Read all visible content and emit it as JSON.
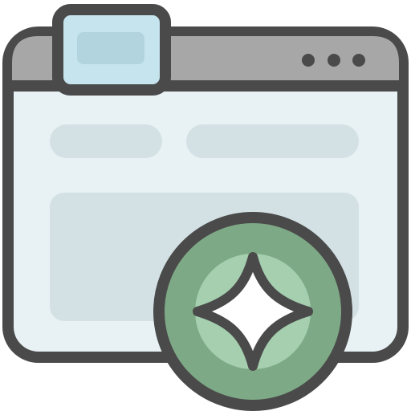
{
  "icon": {
    "name": "browser-window-sparkle-icon",
    "window": {
      "name": "browser-window-icon",
      "colors": {
        "outline": "#4a4a4a",
        "titlebar": "#a7a7a7",
        "tab": "#c6e4ee",
        "tab_inner": "#b1d4df",
        "content": "#e8f1f4",
        "placeholder": "#d3e1e5",
        "dots": "#4a4a4a"
      },
      "dot_count": 3
    },
    "badge": {
      "name": "sparkle-badge-icon",
      "colors": {
        "outer": "#7ea986",
        "inner": "#a5cfaf",
        "star": "#ffffff",
        "outline": "#4a4a4a"
      }
    }
  }
}
